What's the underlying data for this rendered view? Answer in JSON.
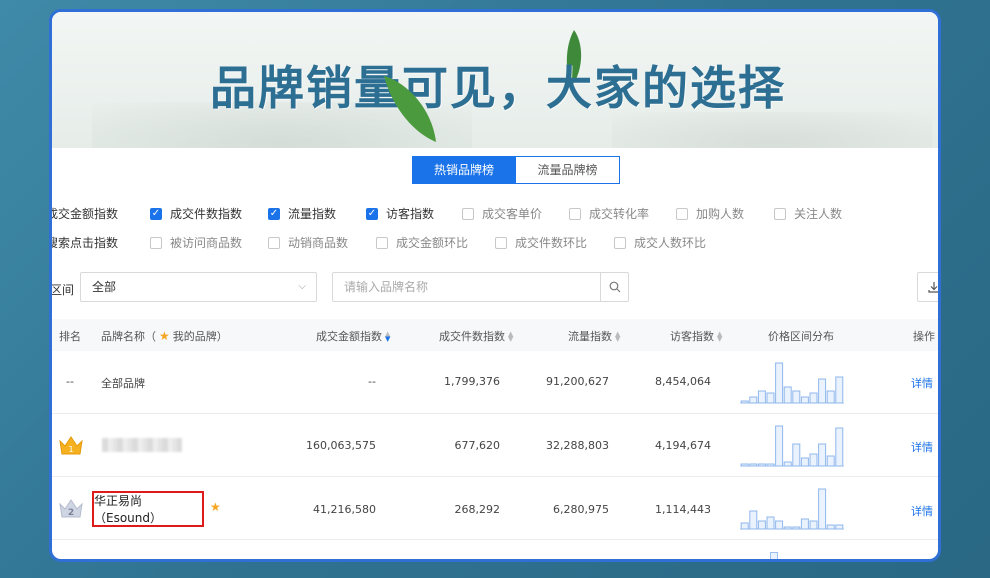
{
  "banner": {
    "title": "品牌销量可见，大家的选择"
  },
  "tabs": [
    {
      "label": "热销品牌榜",
      "active": true
    },
    {
      "label": "流量品牌榜",
      "active": false
    }
  ],
  "filters": {
    "row1": [
      {
        "label": "成交金额指数",
        "checked": null
      },
      {
        "label": "成交件数指数",
        "checked": true
      },
      {
        "label": "流量指数",
        "checked": true
      },
      {
        "label": "访客指数",
        "checked": true
      },
      {
        "label": "成交客单价",
        "checked": false
      },
      {
        "label": "成交转化率",
        "checked": false
      },
      {
        "label": "加购人数",
        "checked": false
      },
      {
        "label": "关注人数",
        "checked": false
      }
    ],
    "row2": [
      {
        "label": "搜索点击指数",
        "checked": null
      },
      {
        "label": "被访问商品数",
        "checked": false
      },
      {
        "label": "动销商品数",
        "checked": false
      },
      {
        "label": "成交金额环比",
        "checked": false
      },
      {
        "label": "成交件数环比",
        "checked": false
      },
      {
        "label": "成交人数环比",
        "checked": false
      }
    ]
  },
  "query": {
    "range_label": "区间",
    "range_value": "全部",
    "search_placeholder": "请输入品牌名称"
  },
  "table": {
    "headers": {
      "rank": "排名",
      "brand": "品牌名称（",
      "my_brand": "我的品牌）",
      "amount": "成交金额指数",
      "count": "成交件数指数",
      "traffic": "流量指数",
      "visitors": "访客指数",
      "price_dist": "价格区间分布",
      "action": "操作"
    },
    "rows": [
      {
        "rank": "--",
        "brand": "全部品牌",
        "amount": "--",
        "count": "1,799,376",
        "traffic": "91,200,627",
        "visitors": "8,454,064",
        "action": "详情",
        "hist": [
          0.05,
          0.15,
          0.3,
          0.25,
          1.0,
          0.4,
          0.3,
          0.15,
          0.25,
          0.6,
          0.3,
          0.65
        ]
      },
      {
        "rank": "1",
        "brand": "",
        "amount": "160,063,575",
        "count": "677,620",
        "traffic": "32,288,803",
        "visitors": "4,194,674",
        "action": "详情",
        "hist": [
          0.05,
          0.05,
          0.05,
          0.05,
          1.0,
          0.1,
          0.55,
          0.2,
          0.3,
          0.55,
          0.25,
          0.95
        ]
      },
      {
        "rank": "2",
        "brand": "华正易尚（Esound）",
        "amount": "41,216,580",
        "count": "268,292",
        "traffic": "6,280,975",
        "visitors": "1,114,443",
        "action": "详情",
        "hist": [
          0.15,
          0.45,
          0.2,
          0.3,
          0.2,
          0.05,
          0.05,
          0.25,
          0.2,
          1.0,
          0.1,
          0.1
        ]
      }
    ]
  },
  "colors": {
    "primary": "#1a73e8",
    "highlight": "#e0191b",
    "title": "#2d6e93",
    "gold": "#f5a623"
  }
}
